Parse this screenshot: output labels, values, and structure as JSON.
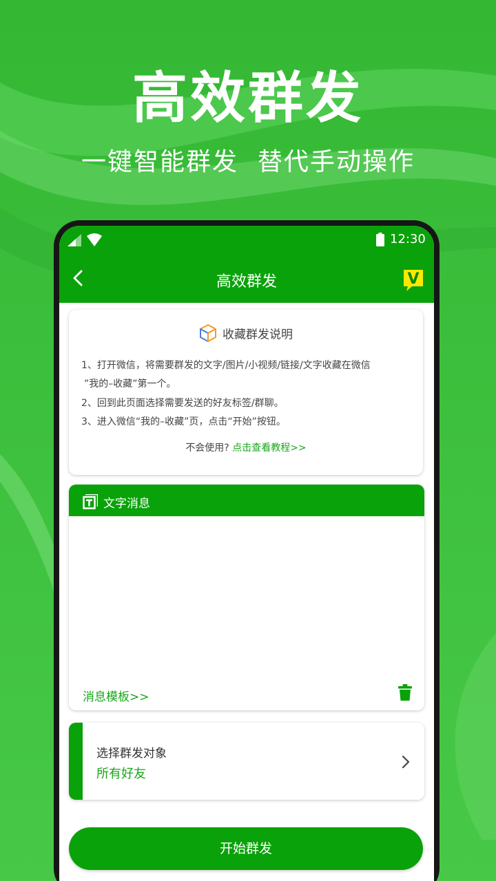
{
  "promo": {
    "title": "高效群发",
    "subtitle_left": "一键智能群发",
    "subtitle_right": "替代手动操作"
  },
  "status_bar": {
    "time": "12:30",
    "icons": [
      "signal-icon",
      "wifi-icon",
      "battery-icon"
    ]
  },
  "app_bar": {
    "title": "高效群发",
    "back_icon": "chevron-left-icon",
    "vip_icon": "vip-badge-icon",
    "vip_letter": "V"
  },
  "instructions": {
    "heading": "收藏群发说明",
    "icon": "cube-icon",
    "lines": [
      "1、打开微信，将需要群发的文字/图片/小视频/链接/文字收藏在微信",
      "”我的–收藏”第一个。",
      "2、回到此页面选择需要发送的好友标签/群聊。",
      "3、进入微信“我的–收藏”页，点击“开始”按钮。"
    ],
    "help_prefix": "不会使用?",
    "help_link": "点击查看教程>>"
  },
  "text_message": {
    "header": "文字消息",
    "header_icon": "text-format-icon",
    "value": "",
    "template_link": "消息模板>>",
    "delete_icon": "trash-icon"
  },
  "target": {
    "label": "选择群发对象",
    "value": "所有好友",
    "chevron_icon": "chevron-right-icon"
  },
  "start_button": {
    "label": "开始群发"
  },
  "colors": {
    "page_green": "#3fc23f",
    "brand_green": "#0aa20a",
    "link_green": "#18a518",
    "vip_yellow": "#ffe800"
  }
}
